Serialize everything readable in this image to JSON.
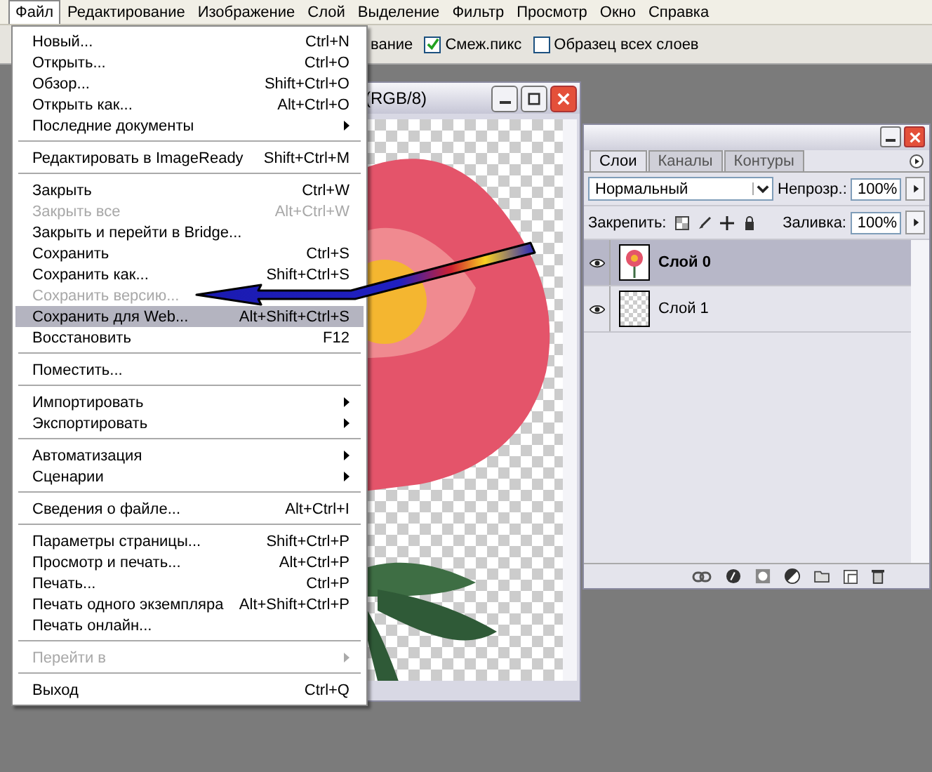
{
  "menubar": [
    {
      "label": "Файл",
      "selected": true
    },
    {
      "label": "Редактирование",
      "selected": false
    },
    {
      "label": "Изображение",
      "selected": false
    },
    {
      "label": "Слой",
      "selected": false
    },
    {
      "label": "Выделение",
      "selected": false
    },
    {
      "label": "Фильтр",
      "selected": false
    },
    {
      "label": "Просмотр",
      "selected": false
    },
    {
      "label": "Окно",
      "selected": false
    },
    {
      "label": "Справка",
      "selected": false
    }
  ],
  "options_bar": {
    "partial_label": "вание",
    "checkboxes": [
      {
        "label": "Смеж.пикс",
        "checked": true
      },
      {
        "label": "Образец всех слоев",
        "checked": false
      }
    ]
  },
  "document_window": {
    "title": "(RGB/8)"
  },
  "file_menu": {
    "groups": [
      [
        {
          "label": "Новый...",
          "shortcut": "Ctrl+N",
          "submenu": false,
          "disabled": false,
          "selected": false
        },
        {
          "label": "Открыть...",
          "shortcut": "Ctrl+O",
          "submenu": false,
          "disabled": false,
          "selected": false
        },
        {
          "label": "Обзор...",
          "shortcut": "Shift+Ctrl+O",
          "submenu": false,
          "disabled": false,
          "selected": false
        },
        {
          "label": "Открыть как...",
          "shortcut": "Alt+Ctrl+O",
          "submenu": false,
          "disabled": false,
          "selected": false
        },
        {
          "label": "Последние документы",
          "submenu": true,
          "disabled": false,
          "selected": false
        }
      ],
      [
        {
          "label": "Редактировать в ImageReady",
          "shortcut": "Shift+Ctrl+M",
          "submenu": false,
          "disabled": false,
          "selected": false
        }
      ],
      [
        {
          "label": "Закрыть",
          "shortcut": "Ctrl+W",
          "submenu": false,
          "disabled": false,
          "selected": false
        },
        {
          "label": "Закрыть все",
          "shortcut": "Alt+Ctrl+W",
          "submenu": false,
          "disabled": true,
          "selected": false
        },
        {
          "label": "Закрыть и перейти в Bridge...",
          "submenu": false,
          "disabled": false,
          "selected": false
        },
        {
          "label": "Сохранить",
          "shortcut": "Ctrl+S",
          "submenu": false,
          "disabled": false,
          "selected": false
        },
        {
          "label": "Сохранить как...",
          "shortcut": "Shift+Ctrl+S",
          "submenu": false,
          "disabled": false,
          "selected": false
        },
        {
          "label": "Сохранить версию...",
          "submenu": false,
          "disabled": true,
          "selected": false
        },
        {
          "label": "Сохранить для Web...",
          "shortcut": "Alt+Shift+Ctrl+S",
          "submenu": false,
          "disabled": false,
          "selected": true
        },
        {
          "label": "Восстановить",
          "shortcut": "F12",
          "submenu": false,
          "disabled": false,
          "selected": false
        }
      ],
      [
        {
          "label": "Поместить...",
          "submenu": false,
          "disabled": false,
          "selected": false
        }
      ],
      [
        {
          "label": "Импортировать",
          "submenu": true,
          "disabled": false,
          "selected": false
        },
        {
          "label": "Экспортировать",
          "submenu": true,
          "disabled": false,
          "selected": false
        }
      ],
      [
        {
          "label": "Автоматизация",
          "submenu": true,
          "disabled": false,
          "selected": false
        },
        {
          "label": "Сценарии",
          "submenu": true,
          "disabled": false,
          "selected": false
        }
      ],
      [
        {
          "label": "Сведения о файле...",
          "shortcut": "Alt+Ctrl+I",
          "submenu": false,
          "disabled": false,
          "selected": false
        }
      ],
      [
        {
          "label": "Параметры страницы...",
          "shortcut": "Shift+Ctrl+P",
          "submenu": false,
          "disabled": false,
          "selected": false
        },
        {
          "label": "Просмотр и печать...",
          "shortcut": "Alt+Ctrl+P",
          "submenu": false,
          "disabled": false,
          "selected": false
        },
        {
          "label": "Печать...",
          "shortcut": "Ctrl+P",
          "submenu": false,
          "disabled": false,
          "selected": false
        },
        {
          "label": "Печать одного экземпляра",
          "shortcut": "Alt+Shift+Ctrl+P",
          "submenu": false,
          "disabled": false,
          "selected": false
        },
        {
          "label": "Печать онлайн...",
          "submenu": false,
          "disabled": false,
          "selected": false
        }
      ],
      [
        {
          "label": "Перейти в",
          "submenu": true,
          "disabled": true,
          "selected": false
        }
      ],
      [
        {
          "label": "Выход",
          "shortcut": "Ctrl+Q",
          "submenu": false,
          "disabled": false,
          "selected": false
        }
      ]
    ]
  },
  "layers_panel": {
    "tabs": [
      {
        "label": "Слои",
        "selected": true
      },
      {
        "label": "Каналы",
        "selected": false
      },
      {
        "label": "Контуры",
        "selected": false
      }
    ],
    "blend_mode": "Нормальный",
    "opacity_label": "Непрозр.:",
    "opacity": "100%",
    "lock_label": "Закрепить:",
    "fill_label": "Заливка:",
    "fill": "100%",
    "layers": [
      {
        "name": "Слой 0",
        "kind": "image",
        "visible": true,
        "selected": true
      },
      {
        "name": "Слой 1",
        "kind": "empty",
        "visible": true,
        "selected": false
      }
    ]
  }
}
